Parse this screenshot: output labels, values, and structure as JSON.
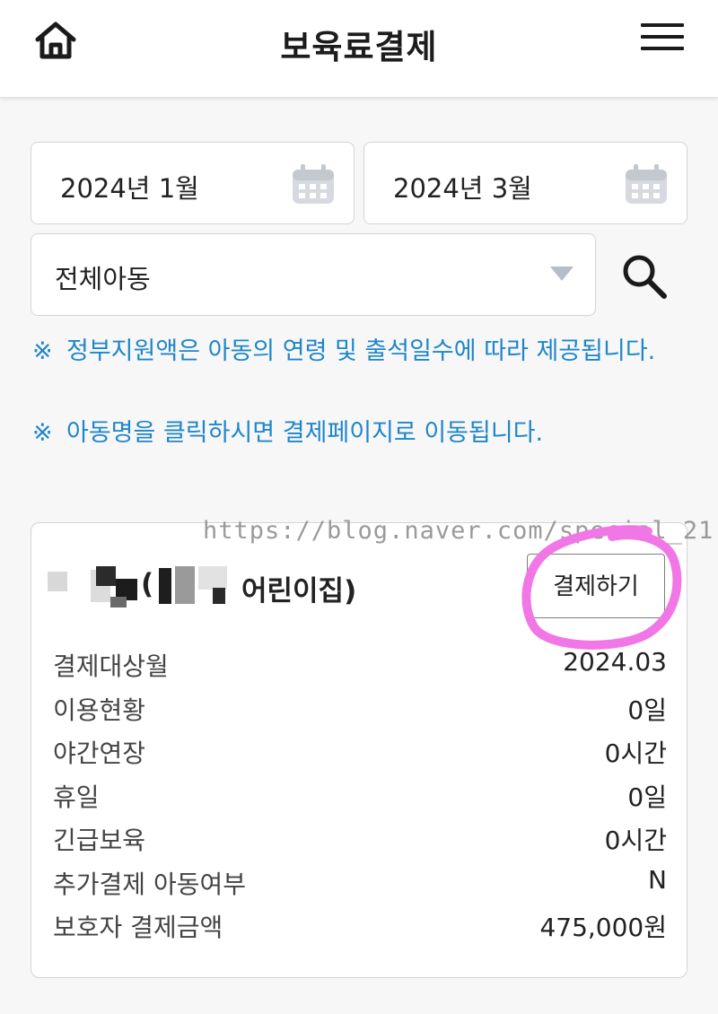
{
  "header": {
    "title": "보육료결제",
    "home_icon": "home-icon",
    "menu_icon": "hamburger-menu-icon"
  },
  "filters": {
    "start_month": "2024년 1월",
    "end_month": "2024년 3월",
    "child_select": "전체아동",
    "calendar_icon": "calendar-icon",
    "search_icon": "search-icon"
  },
  "notes": [
    {
      "mark": "※",
      "text": "정부지원액은 아동의 연령 및 출석일수에 따라 제공됩니다."
    },
    {
      "mark": "※",
      "text": "아동명을 클릭하시면 결제페이지로 이동됩니다."
    }
  ],
  "watermark": "https://blog.naver.com/special_21",
  "card": {
    "open_paren": "(",
    "daycare_suffix": "어린이집)",
    "pay_button": "결제하기",
    "highlight_color": "#f277e6",
    "rows": [
      {
        "label": "결제대상월",
        "value": "2024.03"
      },
      {
        "label": "이용현황",
        "value": "0일"
      },
      {
        "label": "야간연장",
        "value": "0시간"
      },
      {
        "label": "휴일",
        "value": "0일"
      },
      {
        "label": "긴급보육",
        "value": "0시간"
      },
      {
        "label": "추가결제 아동여부",
        "value": "N"
      },
      {
        "label": "보호자 결제금액",
        "value": "475,000원"
      }
    ]
  },
  "colors": {
    "note_blue": "#1f86c9",
    "border": "#d4d4d8"
  }
}
